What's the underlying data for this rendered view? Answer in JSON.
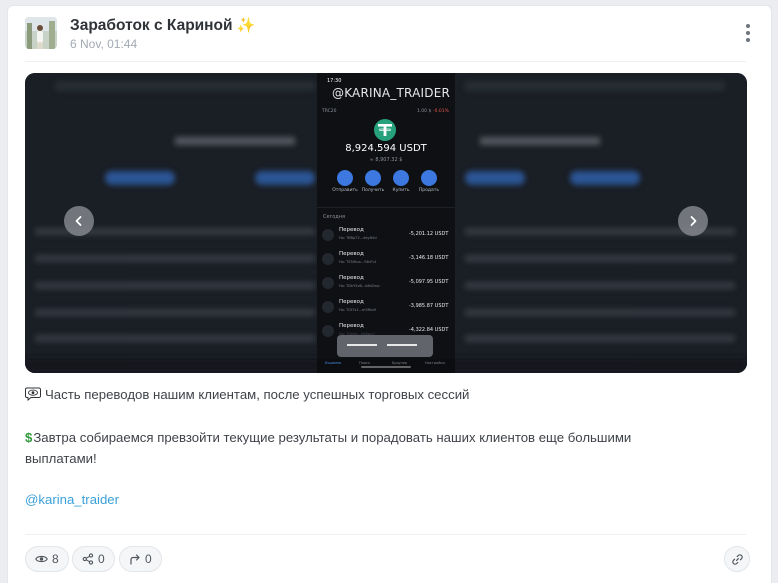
{
  "post": {
    "channel_title": "Заработок с Кариной",
    "date": "6 Nov, 01:44",
    "paragraph1": "Часть переводов нашим клиентам, после успешных торговых сессий",
    "paragraph2_line1": "Завтра собираемся превзойти текущие результаты и порадовать наших клиентов еще большими",
    "paragraph2_line2": "выплатами!",
    "mention": "@karina_traider",
    "icons": {
      "avatar": "avatar-photo",
      "title_emoji": "sparkles-icon",
      "menu": "more-vertical-icon",
      "paragraph1_emoji": "eye-in-speech-bubble-icon",
      "paragraph2_emoji": "dollar-sign-icon"
    }
  },
  "media": {
    "watermark": "@KARINA_TRAIDER",
    "phone": {
      "status_time": "17:30",
      "token_label": "TRC20",
      "price": "1.00 $",
      "price_change": "-0.01%",
      "balance": "8,924.594 USDT",
      "balance_fiat": "≈ 8,907.32 $",
      "actions": [
        "Отправить",
        "Получить",
        "Купить",
        "Продать"
      ],
      "section_label": "Сегодня",
      "transactions": [
        {
          "name": "Перевод",
          "address": "На: TBRp72...4eyN5d",
          "amount": "-5,201.12 USDT"
        },
        {
          "name": "Перевод",
          "address": "На: TS3t9ua...Y4kFv1",
          "amount": "-3,146.18 USDT"
        },
        {
          "name": "Перевод",
          "address": "На: TDhY5vB...k8d2mp",
          "amount": "-5,097.95 USDT"
        },
        {
          "name": "Перевод",
          "address": "На: TGf7x1...m3Rks9",
          "amount": "-3,985.87 USDT"
        },
        {
          "name": "Перевод",
          "address": "На: TQe2b...Hk8wu7",
          "amount": "-4,322.84 USDT"
        }
      ],
      "tabbar": [
        "Кошелек",
        "Поиск",
        "Браузер",
        "Настройки"
      ]
    }
  },
  "stats": {
    "views": "8",
    "shares": "0",
    "forwards": "0"
  },
  "colors": {
    "accent_link": "#3aa0d8",
    "usdt_green": "#26a17b",
    "action_blue": "#3c78e0"
  }
}
